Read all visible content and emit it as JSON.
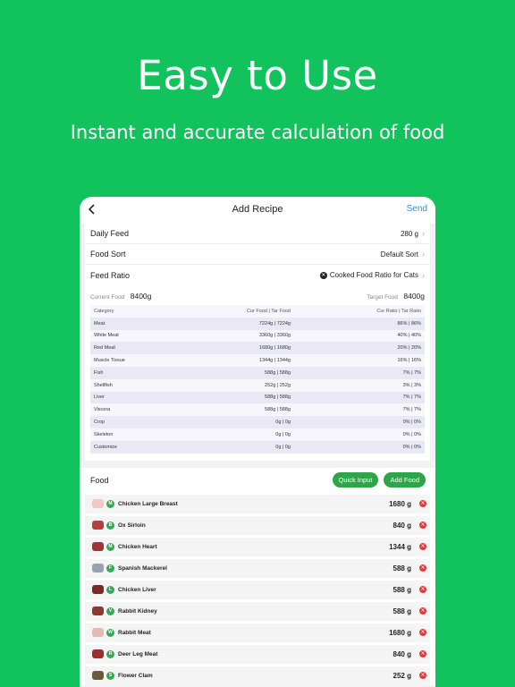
{
  "hero": {
    "title": "Easy to Use",
    "subtitle": "Instant and accurate calculation of food"
  },
  "navbar": {
    "back_icon": "chevron-left-icon",
    "title": "Add Recipe",
    "send": "Send"
  },
  "settings": {
    "daily_feed": {
      "label": "Daily Feed",
      "value": "280 g"
    },
    "food_sort": {
      "label": "Food Sort",
      "value": "Default Sort"
    },
    "feed_ratio": {
      "label": "Feed Ratio",
      "value": "Cooked Food Ratio for Cats"
    }
  },
  "totals": {
    "current_label": "Current Food",
    "current_value": "8400g",
    "target_label": "Target Food",
    "target_value": "8400g"
  },
  "ratio_table": {
    "headers": {
      "category": "Category",
      "food": "Cur Food | Tar Food",
      "ratio": "Cur Ratio | Tar Ratio"
    },
    "rows": [
      {
        "category": "Meat",
        "food": "7224g | 7224g",
        "ratio": "86% | 86%"
      },
      {
        "category": "White Meat",
        "food": "3360g | 3360g",
        "ratio": "40% | 40%"
      },
      {
        "category": "Red Meat",
        "food": "1680g | 1680g",
        "ratio": "20% | 20%"
      },
      {
        "category": "Muscle Tissue",
        "food": "1344g | 1344g",
        "ratio": "16% | 16%"
      },
      {
        "category": "Fish",
        "food": "588g | 588g",
        "ratio": "7% | 7%"
      },
      {
        "category": "Shellfish",
        "food": "252g | 252g",
        "ratio": "3% | 3%"
      },
      {
        "category": "Liver",
        "food": "588g | 588g",
        "ratio": "7% | 7%"
      },
      {
        "category": "Viscera",
        "food": "588g | 588g",
        "ratio": "7% | 7%"
      },
      {
        "category": "Crop",
        "food": "0g | 0g",
        "ratio": "0% | 0%"
      },
      {
        "category": "Skeleton",
        "food": "0g | 0g",
        "ratio": "0% | 0%"
      },
      {
        "category": "Customize",
        "food": "0g | 0g",
        "ratio": "0% | 0%"
      }
    ]
  },
  "food": {
    "title": "Food",
    "quick_input": "Quick Input",
    "add_food": "Add Food",
    "items": [
      {
        "badge": "M",
        "name": "Chicken Large Breast",
        "amount": "1680 g",
        "thumb_color": "#f3c6c6"
      },
      {
        "badge": "B",
        "name": "Ox Sirloin",
        "amount": "840 g",
        "thumb_color": "#b54040"
      },
      {
        "badge": "M",
        "name": "Chicken Heart",
        "amount": "1344 g",
        "thumb_color": "#a03535"
      },
      {
        "badge": "F",
        "name": "Spanish Mackerel",
        "amount": "588 g",
        "thumb_color": "#9aa3ad"
      },
      {
        "badge": "L",
        "name": "Chicken Liver",
        "amount": "588 g",
        "thumb_color": "#7a2a22"
      },
      {
        "badge": "V",
        "name": "Rabbit Kidney",
        "amount": "588 g",
        "thumb_color": "#8c3a30"
      },
      {
        "badge": "W",
        "name": "Rabbit Meat",
        "amount": "1680 g",
        "thumb_color": "#e5b9b0"
      },
      {
        "badge": "R",
        "name": "Deer Leg Meat",
        "amount": "840 g",
        "thumb_color": "#9b2f2f"
      },
      {
        "badge": "S",
        "name": "Flower Clam",
        "amount": "252 g",
        "thumb_color": "#6b5a3a"
      }
    ]
  },
  "colors": {
    "background": "#12c25c",
    "accent_blue": "#2f8fe0",
    "button_green": "#2fa54a",
    "delete_red": "#e53935"
  }
}
